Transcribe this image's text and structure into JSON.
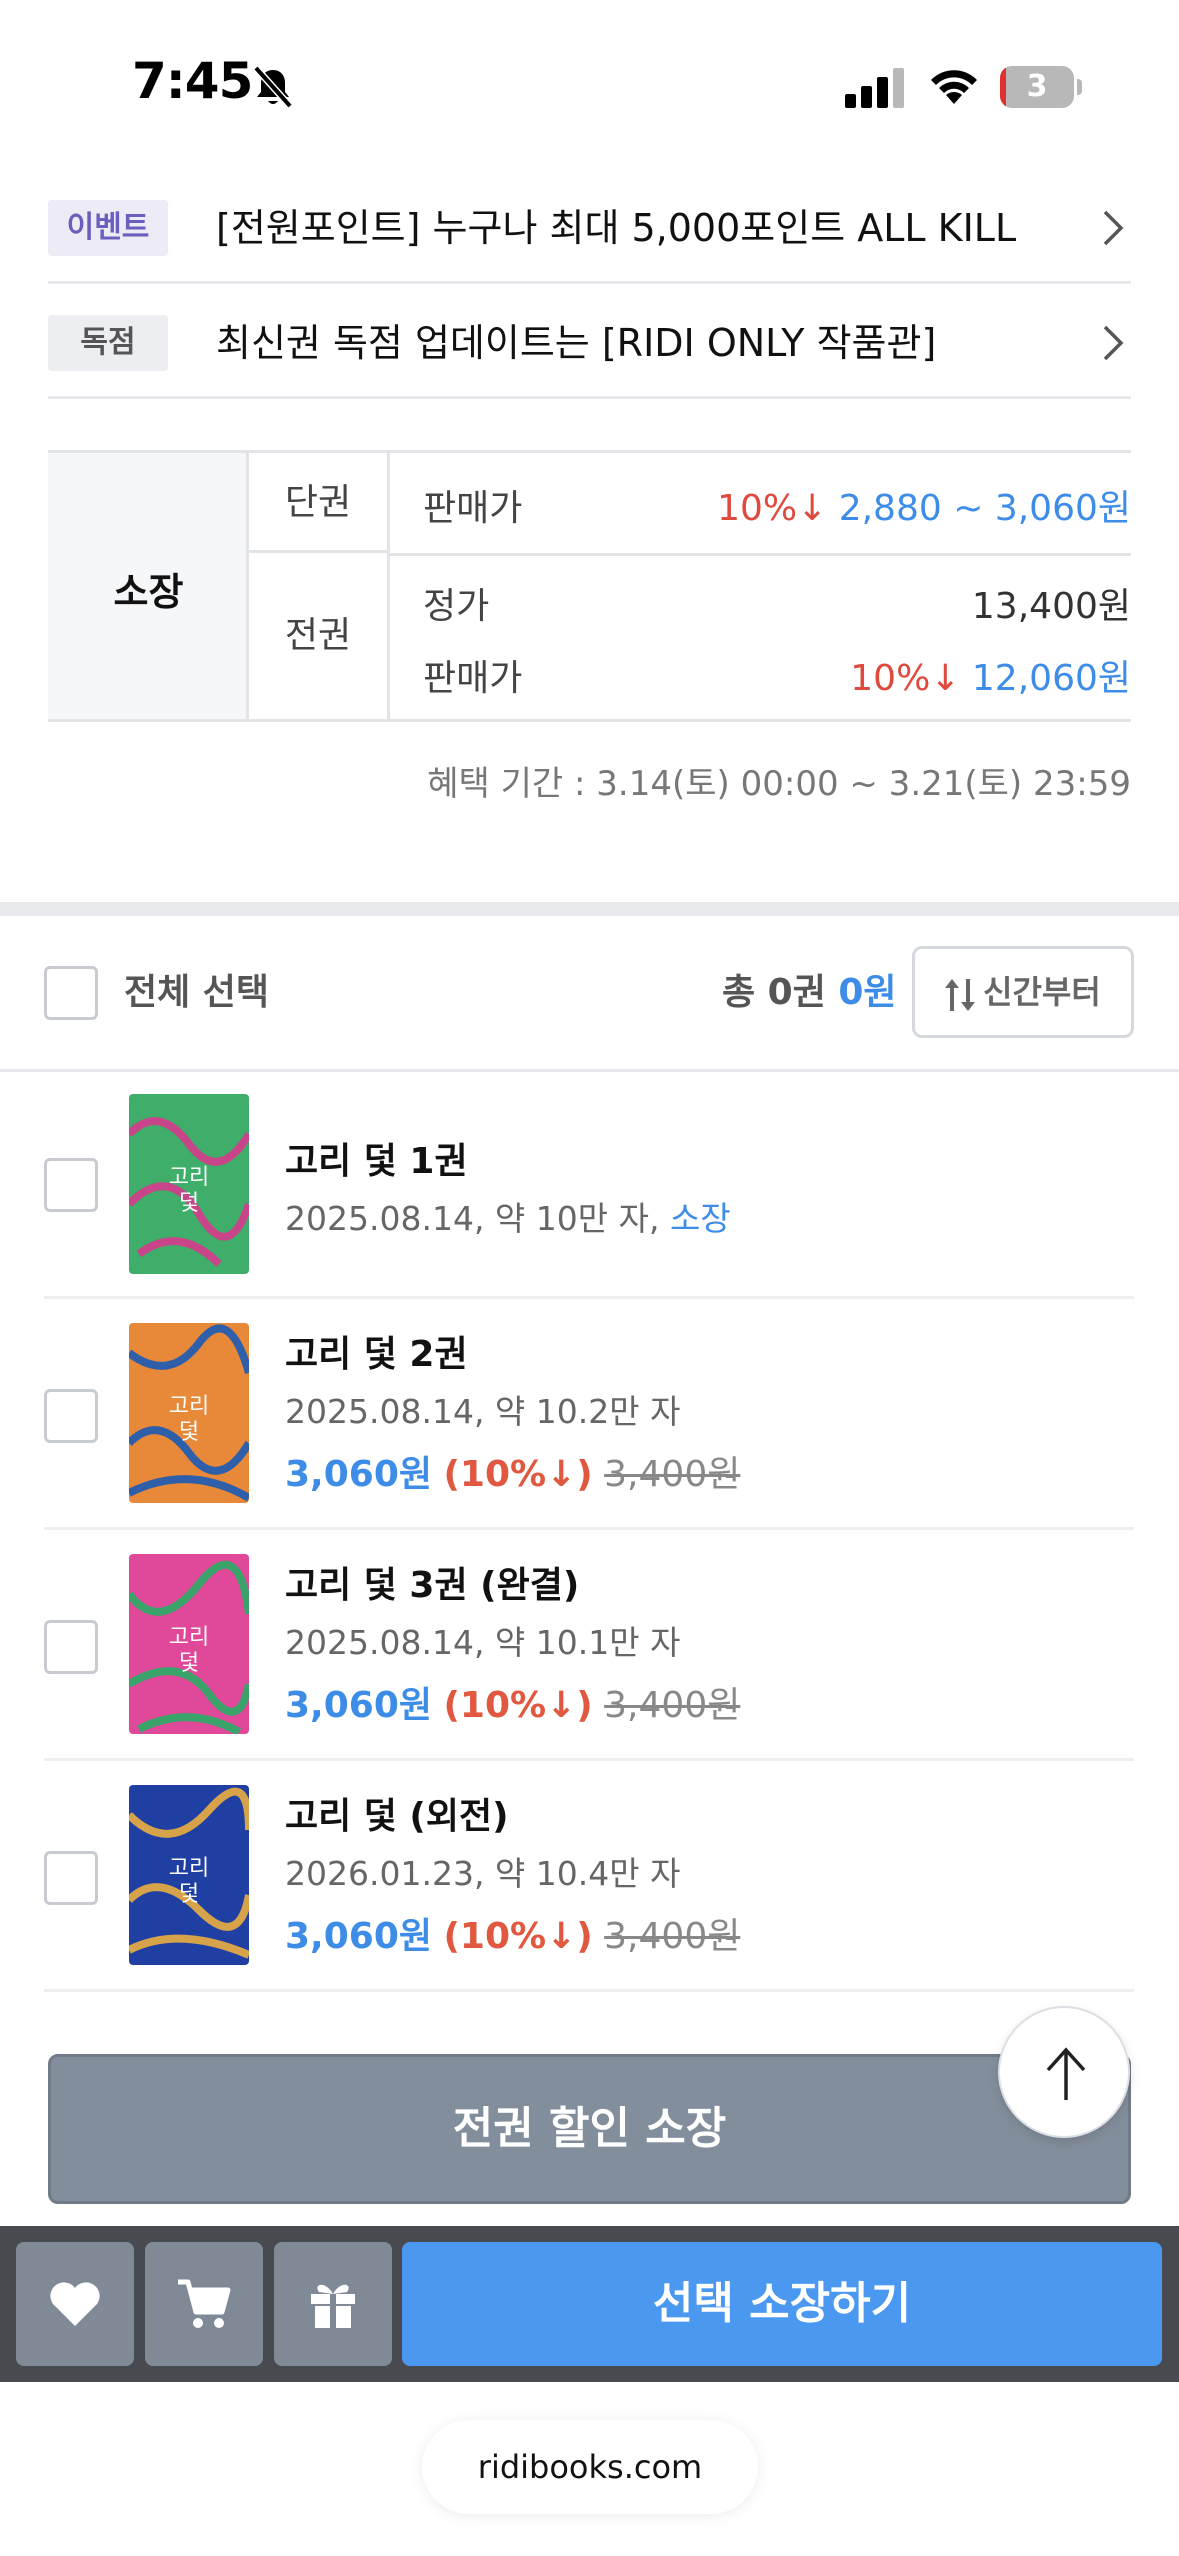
{
  "status_bar": {
    "time": "7:45",
    "battery": "3"
  },
  "notices": [
    {
      "tag": "이벤트",
      "text": "[전원포인트] 누구나 최대 5,000포인트 ALL KILL"
    },
    {
      "tag": "독점",
      "text": "최신권 독점 업데이트는 [RIDI ONLY 작품관]"
    }
  ],
  "price_table": {
    "owner_label": "소장",
    "single": {
      "kind": "단권",
      "label": "판매가",
      "discount": "10%↓",
      "price": "2,880 ~ 3,060원"
    },
    "full": {
      "kind": "전권",
      "list_label": "정가",
      "list_price": "13,400원",
      "sale_label": "판매가",
      "discount": "10%↓",
      "sale_price": "12,060원"
    },
    "period": "혜택 기간 : 3.14(토) 00:00 ~ 3.21(토) 23:59"
  },
  "selection": {
    "select_all_label": "전체 선택",
    "total_prefix": "총 0권",
    "total_amount": "0원",
    "sort_label": "신간부터"
  },
  "books": [
    {
      "title": "고리 덫 1권",
      "meta": "2025.08.14, 약 10만 자, ",
      "owned": "소장",
      "price": "",
      "discount": "",
      "original": "",
      "cover_color": "#3fae6a"
    },
    {
      "title": "고리 덫 2권",
      "meta": "2025.08.14, 약 10.2만 자",
      "owned": "",
      "price": "3,060원",
      "discount": "(10%↓)",
      "original": "3,400원",
      "cover_color": "#e8893a"
    },
    {
      "title": "고리 덫 3권 (완결)",
      "meta": "2025.08.14, 약 10.1만 자",
      "owned": "",
      "price": "3,060원",
      "discount": "(10%↓)",
      "original": "3,400원",
      "cover_color": "#e0499a"
    },
    {
      "title": "고리 덫 (외전)",
      "meta": "2026.01.23, 약 10.4만 자",
      "owned": "",
      "price": "3,060원",
      "discount": "(10%↓)",
      "original": "3,400원",
      "cover_color": "#1f3fa3"
    }
  ],
  "buttons": {
    "bulk_buy": "전권 할인 소장",
    "buy_selected": "선택 소장하기"
  },
  "icons": {
    "wishlist": "heart-icon",
    "cart": "cart-icon",
    "gift": "gift-icon",
    "scroll_top": "arrow-up-icon"
  },
  "url": "ridibooks.com"
}
